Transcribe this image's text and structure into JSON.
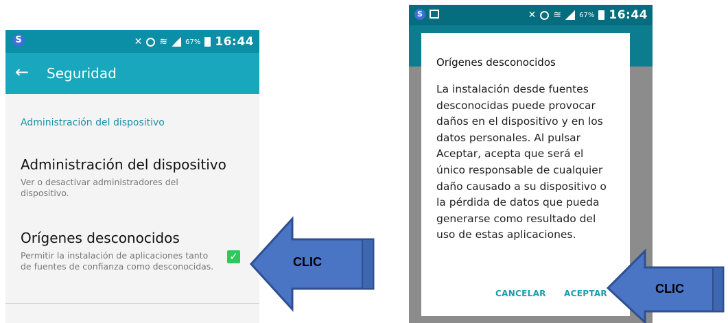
{
  "left_screen": {
    "status": {
      "logo": "S",
      "battery_pct": "67%",
      "time": "16:44"
    },
    "app_bar": {
      "back_icon": "←",
      "title": "Seguridad"
    },
    "section_header": "Administración del dispositivo",
    "items": [
      {
        "title": "Administración del dispositivo",
        "subtitle": "Ver o desactivar administradores del dispositivo."
      },
      {
        "title": "Orígenes desconocidos",
        "subtitle": "Permitir la instalación de aplicaciones tanto de fuentes de confianza como desconocidas.",
        "checked": true
      }
    ],
    "check_mark": "✓"
  },
  "right_screen": {
    "status": {
      "logo": "S",
      "battery_pct": "67%",
      "time": "16:44"
    },
    "dialog": {
      "title": "Orígenes desconocidos",
      "body": "La instalación desde fuentes desconocidas puede provocar daños en el dispositivo y en los datos personales. Al pulsar Aceptar, acepta que será el único responsable de cualquier daño causado a su dispositivo o la pérdida de datos que pueda generarse como resultado del uso de estas aplicaciones.",
      "cancel_label": "CANCELAR",
      "accept_label": "ACEPTAR"
    }
  },
  "annotations": {
    "arrow_color": "#4a74c4",
    "arrow_label_1": "CLIC",
    "arrow_label_2": "CLIC"
  }
}
